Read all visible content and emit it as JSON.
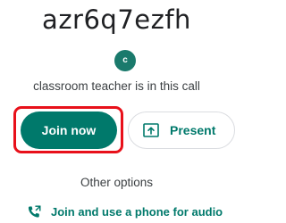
{
  "meeting": {
    "code": "azr6q7ezfh",
    "avatar_initial": "c",
    "status": "classroom teacher is in this call"
  },
  "actions": {
    "join_label": "Join now",
    "present_label": "Present",
    "present_icon": "present-screen-icon"
  },
  "other": {
    "heading": "Other options",
    "phone_label": "Join and use a phone for audio",
    "phone_icon": "phone-icon"
  },
  "colors": {
    "accent": "#00796b",
    "highlight": "#e8101a"
  }
}
